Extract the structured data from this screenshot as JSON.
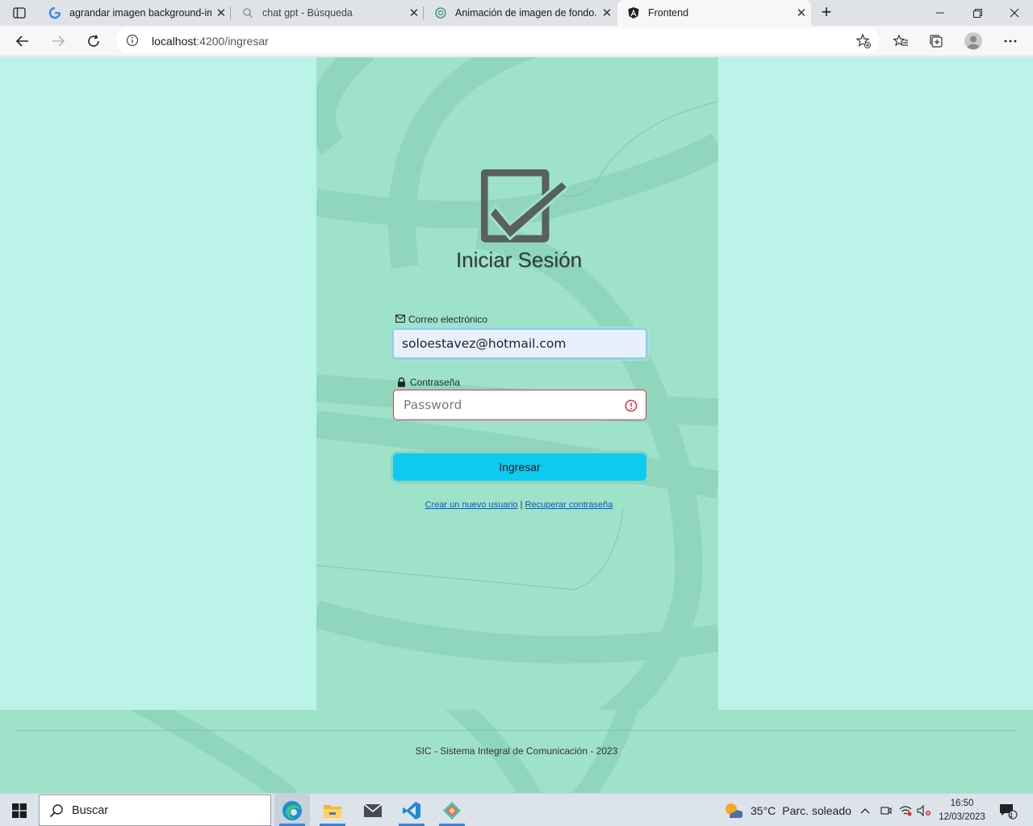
{
  "browser": {
    "tabs": [
      {
        "title": "agrandar imagen background-im",
        "icon": "google-icon"
      },
      {
        "title": "chat gpt - Búsqueda",
        "icon": "search-icon"
      },
      {
        "title": "Animación de imagen de fondo.",
        "icon": "chatgpt-icon"
      },
      {
        "title": "Frontend",
        "icon": "angular-icon"
      }
    ],
    "address": {
      "host": "localhost",
      "path": ":4200/ingresar"
    }
  },
  "login": {
    "title": "Iniciar Sesión",
    "email_label": "Correo electrónico",
    "email_value": "soloestavez@hotmail.com",
    "password_label": "Contraseña",
    "password_placeholder": "Password",
    "submit_label": "Ingresar",
    "create_user_link": "Crear un nuevo usuario",
    "links_separator": "|",
    "recover_link": "Recuperar contraseña"
  },
  "footer": {
    "text": "SIC - Sistema Integral de Comunicación - 2023"
  },
  "taskbar": {
    "search_placeholder": "Buscar",
    "weather": {
      "temp": "35°C",
      "condition": "Parc. soleado"
    },
    "time": "16:50",
    "date": "12/03/2023",
    "notifications": "4"
  },
  "colors": {
    "page_bg": "#bbf3e9",
    "panel_bg": "#9ee2c9",
    "button": "#0dcaf0",
    "error": "#dc3545",
    "link": "#0a58ca"
  }
}
